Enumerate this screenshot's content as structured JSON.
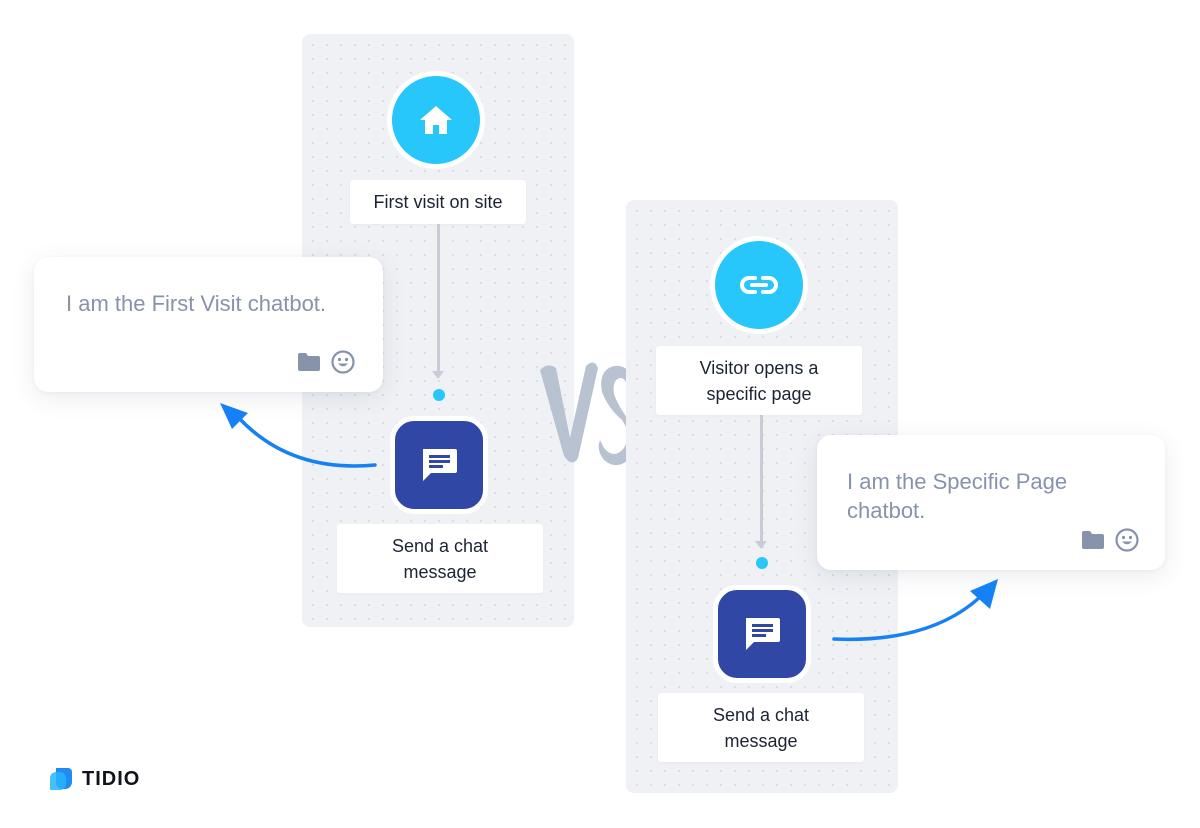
{
  "comparison": {
    "separator_label": "VS"
  },
  "flows": [
    {
      "name": "first-visit",
      "trigger": {
        "icon": "home-icon",
        "label": "First visit on site"
      },
      "action": {
        "icon": "chat-message-icon",
        "label_line1": "Send a chat",
        "label_line2": "message"
      },
      "bubble": {
        "text": "I am the First Visit chatbot.",
        "icons": [
          "folder-icon",
          "smiley-icon"
        ]
      }
    },
    {
      "name": "specific-page",
      "trigger": {
        "icon": "link-icon",
        "label_line1": "Visitor opens a",
        "label_line2": "specific page"
      },
      "action": {
        "icon": "chat-message-icon",
        "label_line1": "Send a chat",
        "label_line2": "message"
      },
      "bubble": {
        "text_line1": "I am the Specific Page",
        "text_line2": "chatbot.",
        "icons": [
          "folder-icon",
          "smiley-icon"
        ]
      }
    }
  ],
  "brand": {
    "name": "TIDIO",
    "colors": {
      "trigger": "#27c6fb",
      "action": "#3047a6",
      "arrow": "#1681f5",
      "bubble_text": "#8793ab",
      "panel": "#eff1f5"
    }
  }
}
